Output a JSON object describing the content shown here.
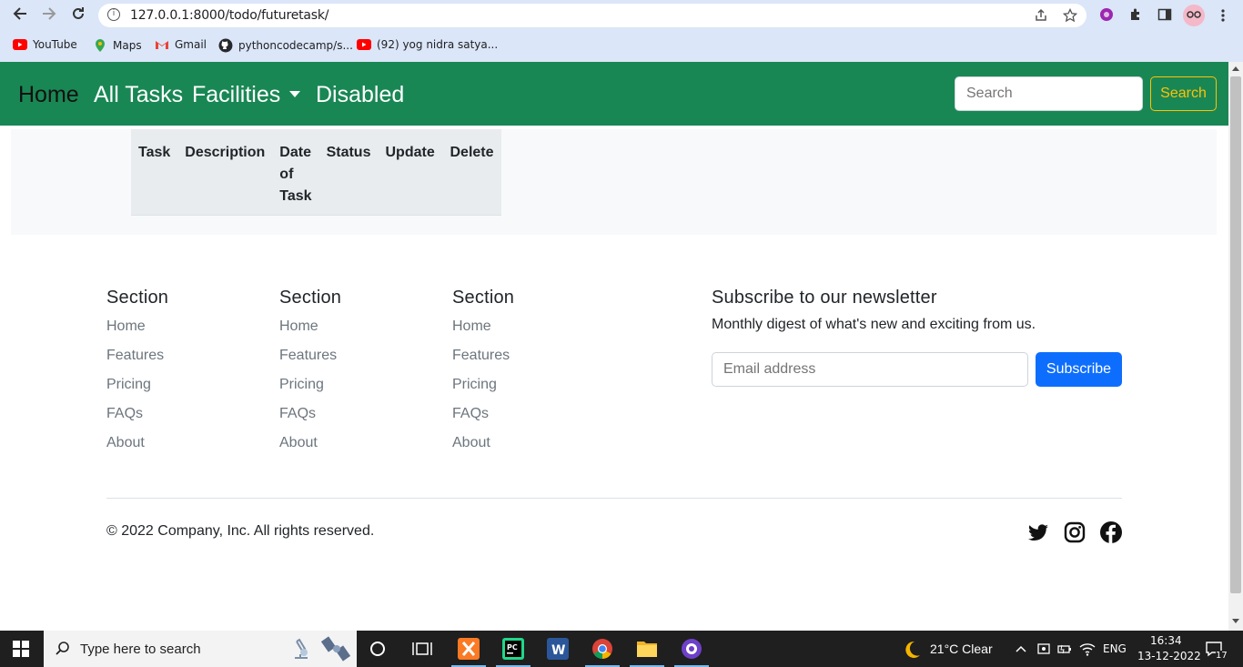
{
  "browser": {
    "url": "127.0.0.1:8000/todo/futuretask/",
    "bookmarks": [
      {
        "label": "YouTube",
        "icon": "youtube-icon",
        "color": "#ff0000"
      },
      {
        "label": "Maps",
        "icon": "maps-icon",
        "color": "#34a853"
      },
      {
        "label": "Gmail",
        "icon": "gmail-icon",
        "color": "#ea4335"
      },
      {
        "label": "pythoncodecamp/s...",
        "icon": "github-icon",
        "color": "#24292e"
      },
      {
        "label": "(92) yog nidra satya...",
        "icon": "youtube-icon",
        "color": "#ff0000"
      }
    ]
  },
  "navbar": {
    "home": "Home",
    "all_tasks": "All Tasks",
    "facilities": "Facilities",
    "disabled": "Disabled",
    "search_placeholder": "Search",
    "search_button": "Search",
    "bg_color": "#198754"
  },
  "table": {
    "headers": [
      "Task",
      "Description",
      "Date of Task",
      "Status",
      "Update",
      "Delete"
    ]
  },
  "footer": {
    "columns": [
      {
        "title": "Section",
        "links": [
          "Home",
          "Features",
          "Pricing",
          "FAQs",
          "About"
        ]
      },
      {
        "title": "Section",
        "links": [
          "Home",
          "Features",
          "Pricing",
          "FAQs",
          "About"
        ]
      },
      {
        "title": "Section",
        "links": [
          "Home",
          "Features",
          "Pricing",
          "FAQs",
          "About"
        ]
      }
    ],
    "newsletter": {
      "title": "Subscribe to our newsletter",
      "subtitle": "Monthly digest of what's new and exciting from us.",
      "email_placeholder": "Email address",
      "button": "Subscribe"
    },
    "copyright": "© 2022 Company, Inc. All rights reserved.",
    "social": [
      "twitter-icon",
      "instagram-icon",
      "facebook-icon"
    ]
  },
  "taskbar": {
    "search_placeholder": "Type here to search",
    "weather": "21°C  Clear",
    "language": "ENG",
    "time": "16:34",
    "date": "13-12-2022",
    "notifications": "17"
  }
}
